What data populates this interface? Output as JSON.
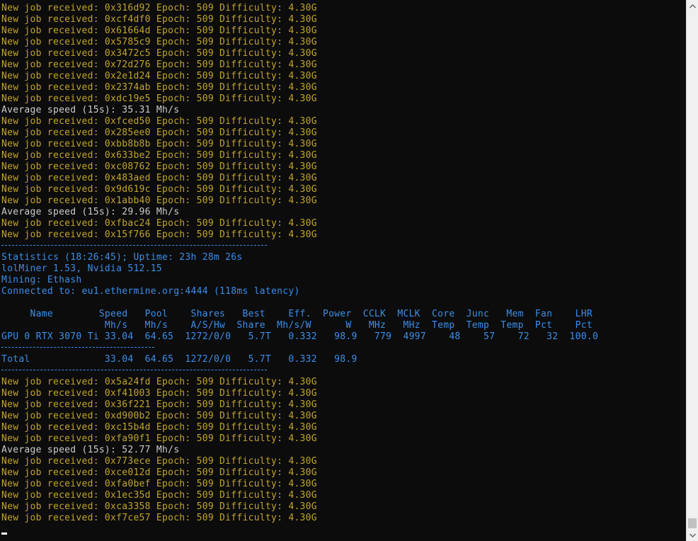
{
  "console": {
    "jobs_block_1": [
      "New job received: 0x316d92 Epoch: 509 Difficulty: 4.30G",
      "New job received: 0xcf4df0 Epoch: 509 Difficulty: 4.30G",
      "New job received: 0x61664d Epoch: 509 Difficulty: 4.30G",
      "New job received: 0x5785c9 Epoch: 509 Difficulty: 4.30G",
      "New job received: 0x3472c5 Epoch: 509 Difficulty: 4.30G",
      "New job received: 0x72d276 Epoch: 509 Difficulty: 4.30G",
      "New job received: 0x2e1d24 Epoch: 509 Difficulty: 4.30G",
      "New job received: 0x2374ab Epoch: 509 Difficulty: 4.30G",
      "New job received: 0xdc19e5 Epoch: 509 Difficulty: 4.30G"
    ],
    "avg_speed_1": "Average speed (15s): 35.31 Mh/s",
    "jobs_block_2": [
      "New job received: 0xfced50 Epoch: 509 Difficulty: 4.30G",
      "New job received: 0x285ee0 Epoch: 509 Difficulty: 4.30G",
      "New job received: 0xbb8b8b Epoch: 509 Difficulty: 4.30G",
      "New job received: 0x633be2 Epoch: 509 Difficulty: 4.30G",
      "New job received: 0xc08762 Epoch: 509 Difficulty: 4.30G",
      "New job received: 0x483aed Epoch: 509 Difficulty: 4.30G",
      "New job received: 0x9d619c Epoch: 509 Difficulty: 4.30G",
      "New job received: 0x1abb40 Epoch: 509 Difficulty: 4.30G"
    ],
    "avg_speed_2": "Average speed (15s): 29.96 Mh/s",
    "jobs_block_3": [
      "New job received: 0xfbac24 Epoch: 509 Difficulty: 4.30G",
      "New job received: 0x15f766 Epoch: 509 Difficulty: 4.30G"
    ],
    "stats": {
      "header": "Statistics (18:26:45); Uptime: 23h 28m 26s",
      "version": "lolMiner 1.53, Nvidia 512.15",
      "mining": "Mining: Ethash",
      "connected": "Connected to: eu1.ethermine.org:4444 (118ms latency)",
      "table_header_1": "     Name        Speed   Pool    Shares   Best    Eff.  Power  CCLK  MCLK  Core  Junc   Mem  Fan    LHR",
      "table_header_2": "                  Mh/s   Mh/s    A/S/Hw  Share  Mh/s/W      W   MHz   MHz  Temp  Temp  Temp  Pct    Pct",
      "gpu_row": "GPU 0 RTX 3070 Ti 33.04  64.65  1272/0/0   5.7T   0.332   98.9   779  4997    48    57    72   32  100.0",
      "total_row": "Total             33.04  64.65  1272/0/0   5.7T   0.332   98.9"
    },
    "jobs_block_4": [
      "New job received: 0x5a24fd Epoch: 509 Difficulty: 4.30G",
      "New job received: 0xf41003 Epoch: 509 Difficulty: 4.30G",
      "New job received: 0x36f221 Epoch: 509 Difficulty: 4.30G",
      "New job received: 0xd900b2 Epoch: 509 Difficulty: 4.30G",
      "New job received: 0xc15b4d Epoch: 509 Difficulty: 4.30G",
      "New job received: 0xfa90f1 Epoch: 509 Difficulty: 4.30G"
    ],
    "avg_speed_3": "Average speed (15s): 52.77 Mh/s",
    "jobs_block_5": [
      "New job received: 0x773ece Epoch: 509 Difficulty: 4.30G",
      "New job received: 0xce012d Epoch: 509 Difficulty: 4.30G",
      "New job received: 0xfa0bef Epoch: 509 Difficulty: 4.30G",
      "New job received: 0x1ec35d Epoch: 509 Difficulty: 4.30G",
      "New job received: 0xca3358 Epoch: 509 Difficulty: 4.30G",
      "New job received: 0xf7ce57 Epoch: 509 Difficulty: 4.30G"
    ]
  },
  "colors": {
    "background": "#0c0c0c",
    "job_text": "#c1a42c",
    "speed_text": "#cccccc",
    "stats_text": "#3b8eea"
  },
  "scrollbar": {
    "up_icon": "chevron-up-icon",
    "down_icon": "chevron-down-icon"
  }
}
